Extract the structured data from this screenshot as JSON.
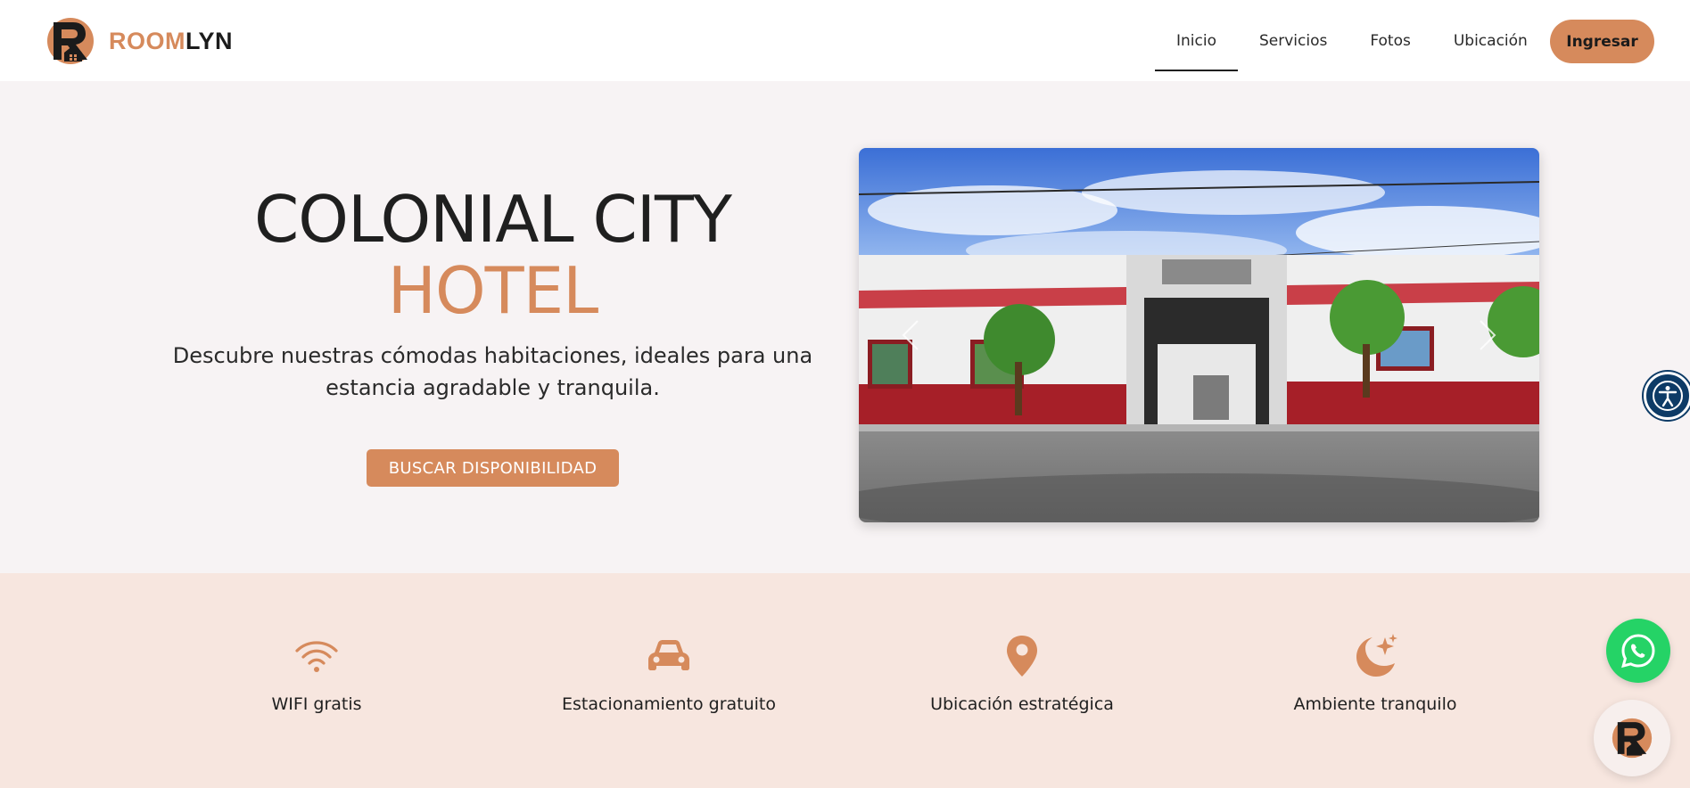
{
  "brand": {
    "part1": "ROOM",
    "part2": "LYN"
  },
  "nav": {
    "items": [
      {
        "label": "Inicio",
        "active": true
      },
      {
        "label": "Servicios",
        "active": false
      },
      {
        "label": "Fotos",
        "active": false
      },
      {
        "label": "Ubicación",
        "active": false
      }
    ],
    "login_label": "Ingresar"
  },
  "hero": {
    "title_line1": "COLONIAL CITY",
    "title_line2": "HOTEL",
    "subtitle": "Descubre nuestras cómodas habitaciones, ideales para una estancia agradable y tranquila.",
    "cta_label": "BUSCAR DISPONIBILIDAD"
  },
  "features": [
    {
      "label": "WIFI gratis",
      "icon": "wifi-icon"
    },
    {
      "label": "Estacionamiento gratuito",
      "icon": "car-icon"
    },
    {
      "label": "Ubicación estratégica",
      "icon": "location-pin-icon"
    },
    {
      "label": "Ambiente tranquilo",
      "icon": "moon-stars-icon"
    }
  ],
  "colors": {
    "accent": "#d68a5c",
    "feature_bg": "#f7e6df",
    "hero_bg": "#f7f3f4",
    "whatsapp": "#25d366",
    "a11y": "#0d3b66"
  }
}
